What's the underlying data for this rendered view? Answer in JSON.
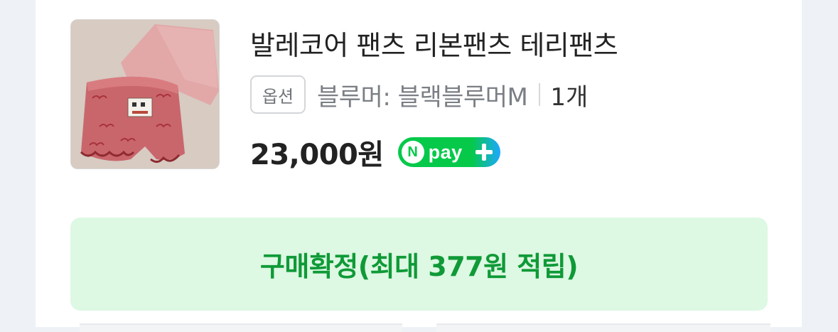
{
  "order_item": {
    "product_name": "발레코어 팬츠 리본팬츠 테리팬츠",
    "option_badge": "옵션",
    "option_value": "블루머: 블랙블루머M",
    "quantity": "1개",
    "price": "23,000원",
    "pay_badge": {
      "n": "N",
      "text": "pay",
      "icon": "plus-icon"
    },
    "confirm_button": "구매확정(최대 377원 적립)"
  },
  "colors": {
    "accent_green": "#0f9a37",
    "button_background": "#ddf8e3",
    "npay_green": "#06c94a",
    "npay_blue": "#1ea8ff"
  }
}
